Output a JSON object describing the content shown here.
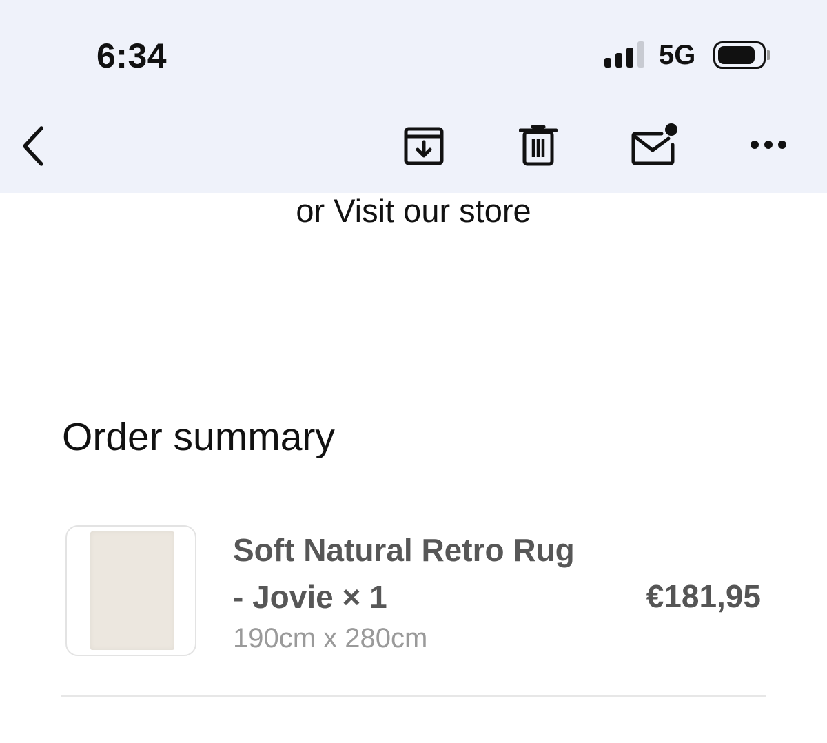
{
  "status_bar": {
    "time": "6:34",
    "network": "5G",
    "signal_bars_active": 3,
    "signal_bars_total": 4,
    "battery_icon": "battery-full-icon"
  },
  "toolbar": {
    "back_icon": "chevron-left-icon",
    "archive_icon": "archive-icon",
    "delete_icon": "trash-icon",
    "mark_unread_icon": "mail-unread-icon",
    "more_icon": "more-horizontal-icon"
  },
  "email_body": {
    "visit_store_text": "or Visit our store",
    "order_summary": {
      "title": "Order summary",
      "items": [
        {
          "name": "Soft Natural Retro Rug - Jovie × 1",
          "variant": "190cm x 280cm",
          "price": "€181,95",
          "image_icon": "rug-thumbnail"
        }
      ]
    }
  },
  "colors": {
    "chrome_background": "#eff2fa",
    "text_primary": "#111111",
    "text_item": "#575757",
    "text_muted": "#9a9a9a"
  }
}
